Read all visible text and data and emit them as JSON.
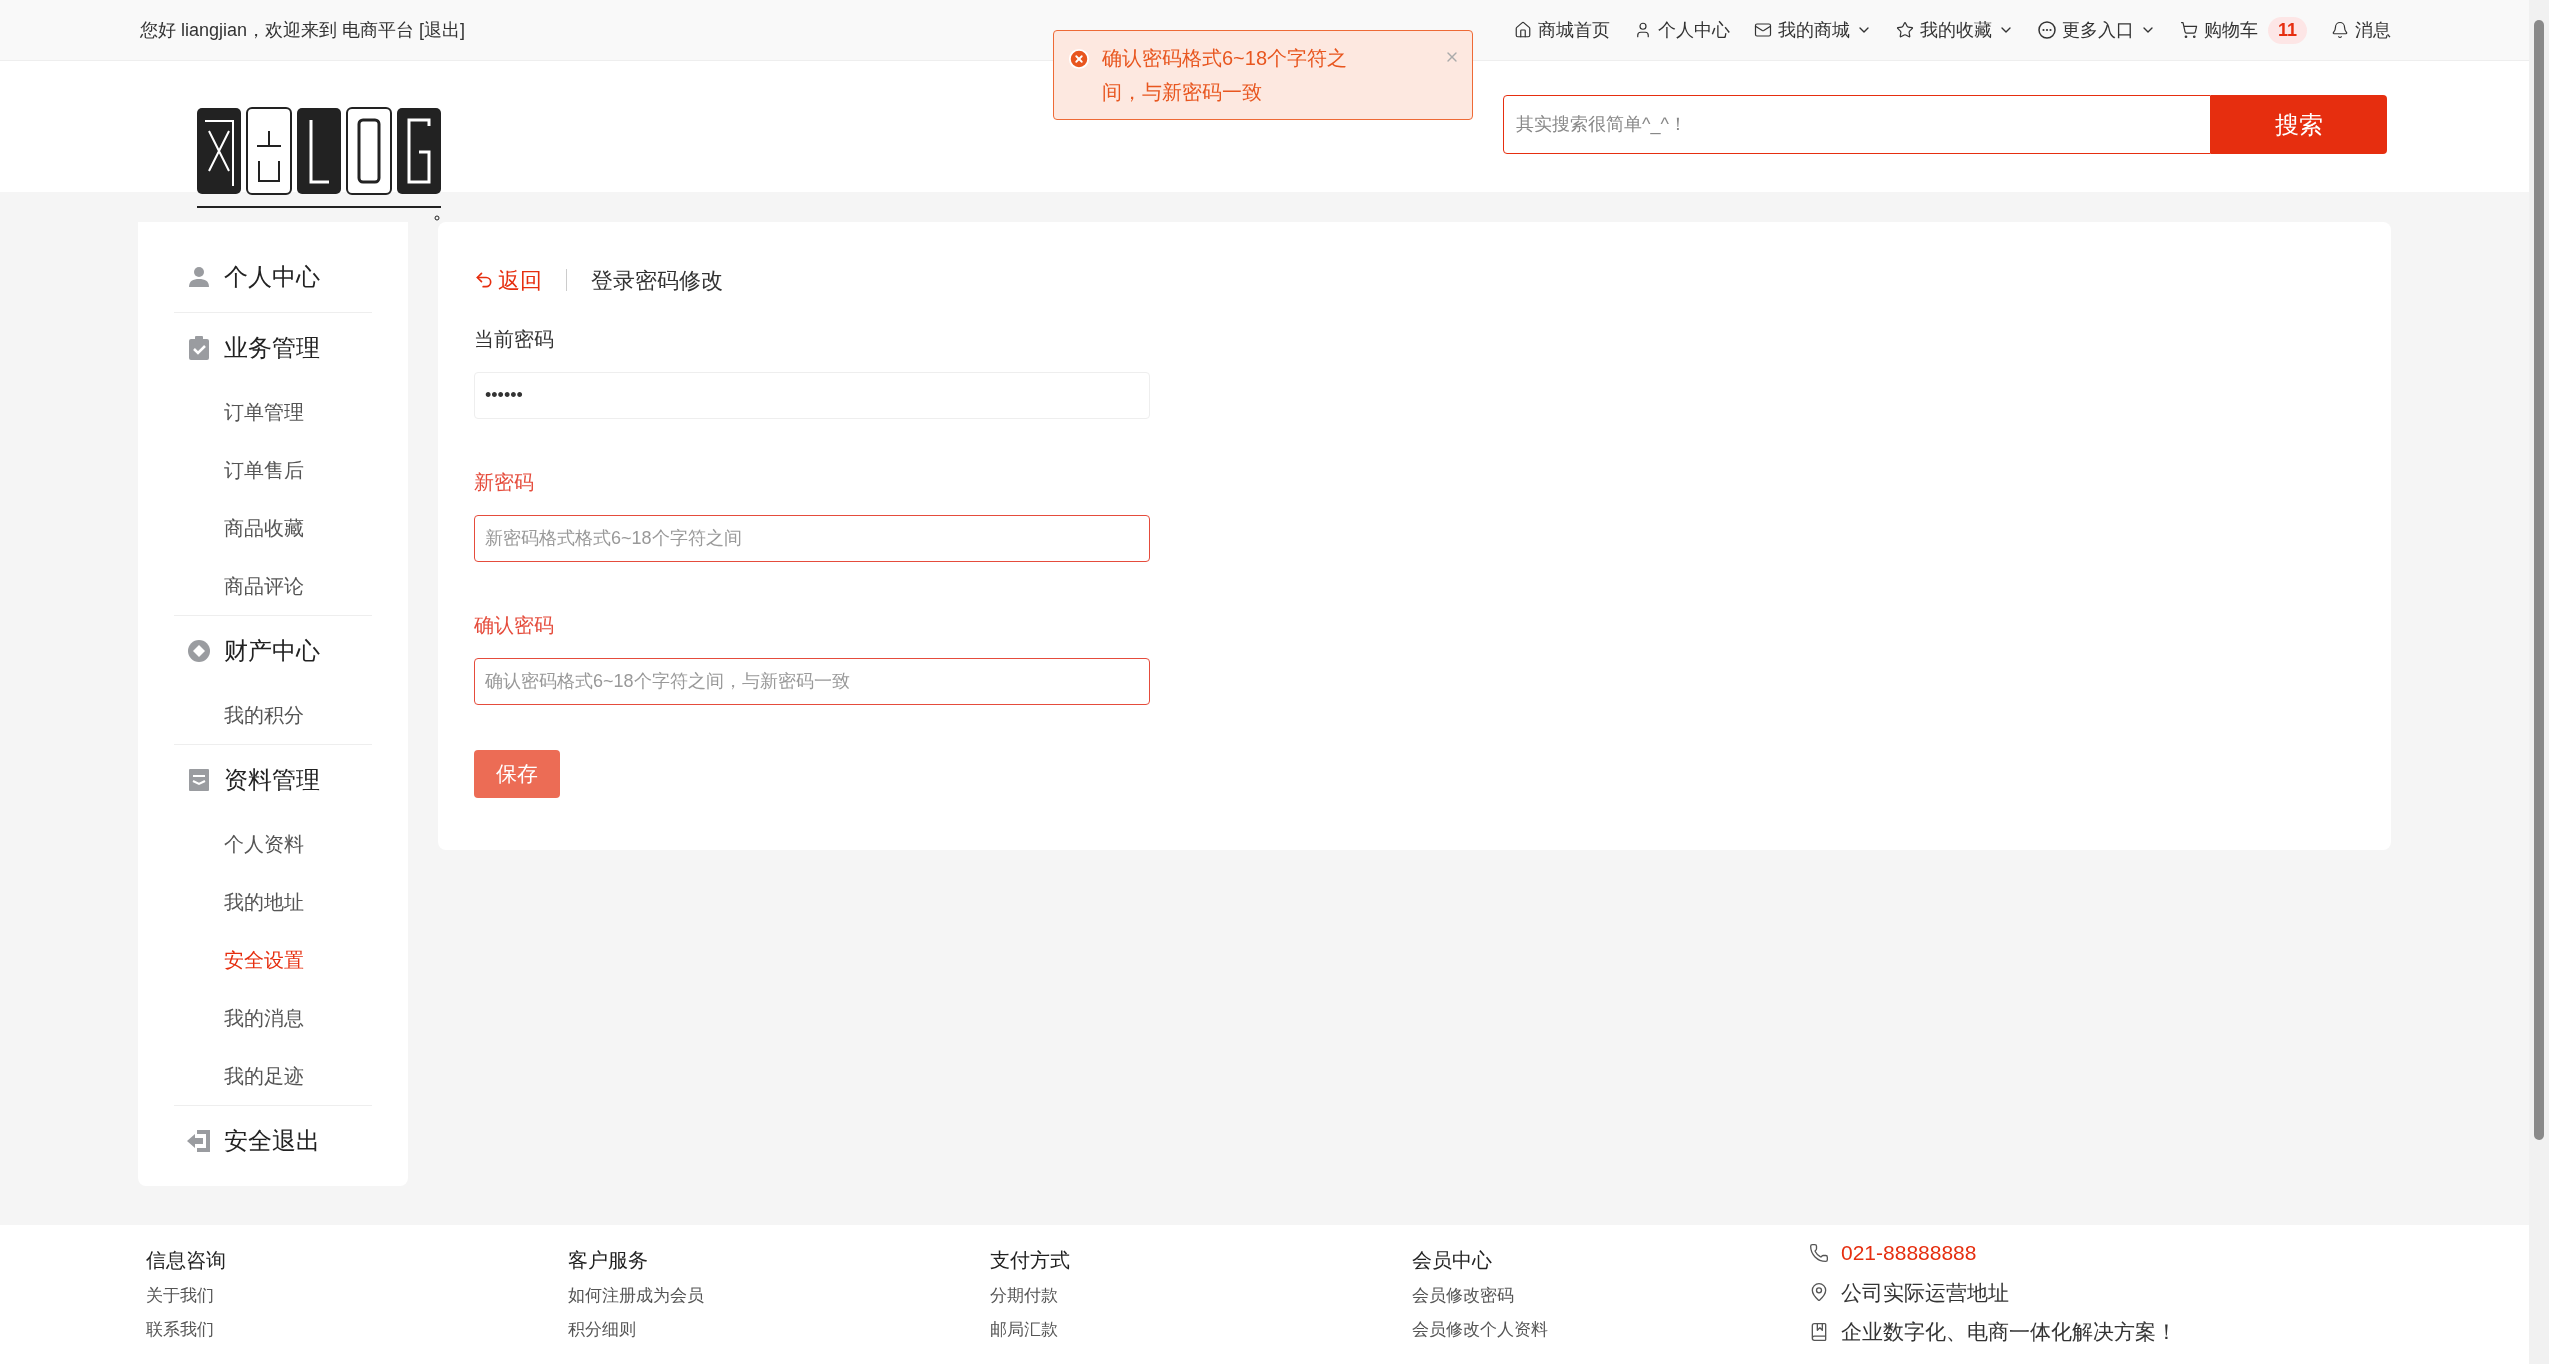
{
  "top_bar": {
    "greeting": "您好 liangjian，欢迎来到 电商平台 [退出]",
    "nav": [
      {
        "label": "商城首页",
        "dropdown": false
      },
      {
        "label": "个人中心",
        "dropdown": false
      },
      {
        "label": "我的商城",
        "dropdown": true
      },
      {
        "label": "我的收藏",
        "dropdown": true
      },
      {
        "label": "更多入口",
        "dropdown": true
      },
      {
        "label": "购物车",
        "dropdown": false,
        "badge": "11"
      },
      {
        "label": "消息",
        "dropdown": false
      }
    ]
  },
  "toast": {
    "message": "确认密码格式6~18个字符之间，与新密码一致"
  },
  "search": {
    "placeholder": "其实搜索很简单^_^！",
    "button": "搜索"
  },
  "sidebar": [
    {
      "title": "个人中心"
    },
    {
      "title": "业务管理",
      "children": [
        {
          "label": "订单管理",
          "selected": false
        },
        {
          "label": "订单售后",
          "selected": false
        },
        {
          "label": "商品收藏",
          "selected": false
        },
        {
          "label": "商品评论",
          "selected": false
        }
      ]
    },
    {
      "title": "财产中心",
      "children": [
        {
          "label": "我的积分",
          "selected": false
        }
      ]
    },
    {
      "title": "资料管理",
      "children": [
        {
          "label": "个人资料",
          "selected": false
        },
        {
          "label": "我的地址",
          "selected": false
        },
        {
          "label": "安全设置",
          "selected": true
        },
        {
          "label": "我的消息",
          "selected": false
        },
        {
          "label": "我的足迹",
          "selected": false
        }
      ]
    },
    {
      "title": "安全退出"
    }
  ],
  "form": {
    "back": "返回",
    "title": "登录密码修改",
    "fields": [
      {
        "label": "当前密码",
        "value": "••••••",
        "error": false
      },
      {
        "label": "新密码",
        "placeholder": "新密码格式格式6~18个字符之间",
        "error": true
      },
      {
        "label": "确认密码",
        "placeholder": "确认密码格式6~18个字符之间，与新密码一致",
        "error": true
      }
    ],
    "save": "保存"
  },
  "footer": {
    "columns": [
      {
        "title": "信息咨询",
        "links": [
          "关于我们",
          "联系我们"
        ]
      },
      {
        "title": "客户服务",
        "links": [
          "如何注册成为会员",
          "积分细则"
        ]
      },
      {
        "title": "支付方式",
        "links": [
          "分期付款",
          "邮局汇款"
        ]
      },
      {
        "title": "会员中心",
        "links": [
          "会员修改密码",
          "会员修改个人资料"
        ]
      }
    ],
    "contact": [
      {
        "kind": "phone",
        "text": "021-88888888"
      },
      {
        "kind": "location",
        "text": "公司实际运营地址"
      },
      {
        "kind": "note",
        "text": "企业数字化、电商一体化解决方案！"
      }
    ]
  }
}
